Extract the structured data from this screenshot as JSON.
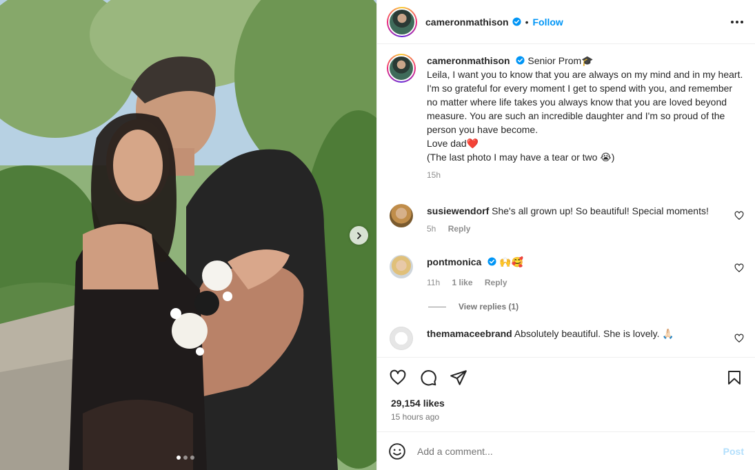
{
  "post": {
    "username": "cameronmathison",
    "follow_label": "Follow",
    "bullet": "•",
    "caption_title": "Senior Prom🎓",
    "caption_text": "Leila, I want you to know that you are always on my mind and in my heart. I'm so grateful for every moment I get to spend with you, and remember no matter where life takes you always know that you are loved beyond measure. You are such an incredible daughter and I'm so proud of the person you have become.\nLove dad❤️\n(The last photo I may have a tear or two 😭)",
    "caption_age": "15h",
    "likes": "29,154 likes",
    "posted": "15 hours ago",
    "carousel": {
      "current": 1,
      "total": 3
    }
  },
  "comments": [
    {
      "username": "susiewendorf",
      "text": "She's all grown up! So beautiful! Special moments!",
      "age": "5h",
      "likes": "",
      "reply": "Reply"
    },
    {
      "username": "pontmonica",
      "text": "🙌🥰",
      "age": "11h",
      "likes": "1 like",
      "reply": "Reply",
      "view_replies": "View replies (1)"
    },
    {
      "username": "themamaceebrand",
      "text": "Absolutely beautiful. She is lovely. 🙏🏻"
    }
  ],
  "composer": {
    "placeholder": "Add a comment...",
    "post_label": "Post"
  },
  "icons": [
    "more-icon",
    "heart-icon",
    "comment-icon",
    "share-icon",
    "bookmark-icon",
    "emoji-icon",
    "chevron-right-icon",
    "verified-badge-icon"
  ],
  "colors": {
    "accent": "#0095f6",
    "verified": "#0095f6",
    "post_disabled": "#b2dffc",
    "text": "#262626",
    "muted": "#737373"
  }
}
